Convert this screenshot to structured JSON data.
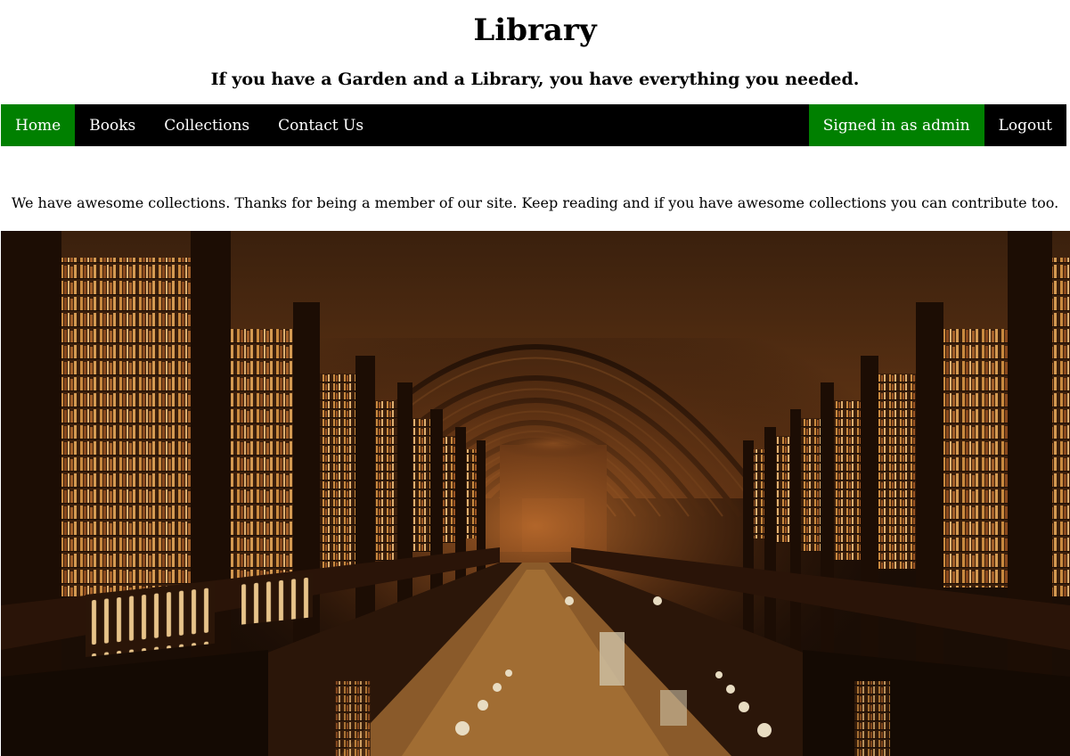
{
  "header": {
    "title": "Library",
    "tagline": "If you have a Garden and a Library, you have everything you needed."
  },
  "nav": {
    "items": [
      {
        "label": "Home",
        "active": true
      },
      {
        "label": "Books",
        "active": false
      },
      {
        "label": "Collections",
        "active": false
      },
      {
        "label": "Contact Us",
        "active": false
      }
    ],
    "signed_in": "Signed in as admin",
    "logout": "Logout"
  },
  "main": {
    "intro": "We have awesome collections. Thanks for being a member of our site. Keep reading and if you have awesome collections you can contribute too."
  },
  "hero": {
    "image": "library-hall-photo"
  },
  "colors": {
    "nav_background": "#000000",
    "active_background": "#008000",
    "nav_text": "#ffffff"
  }
}
